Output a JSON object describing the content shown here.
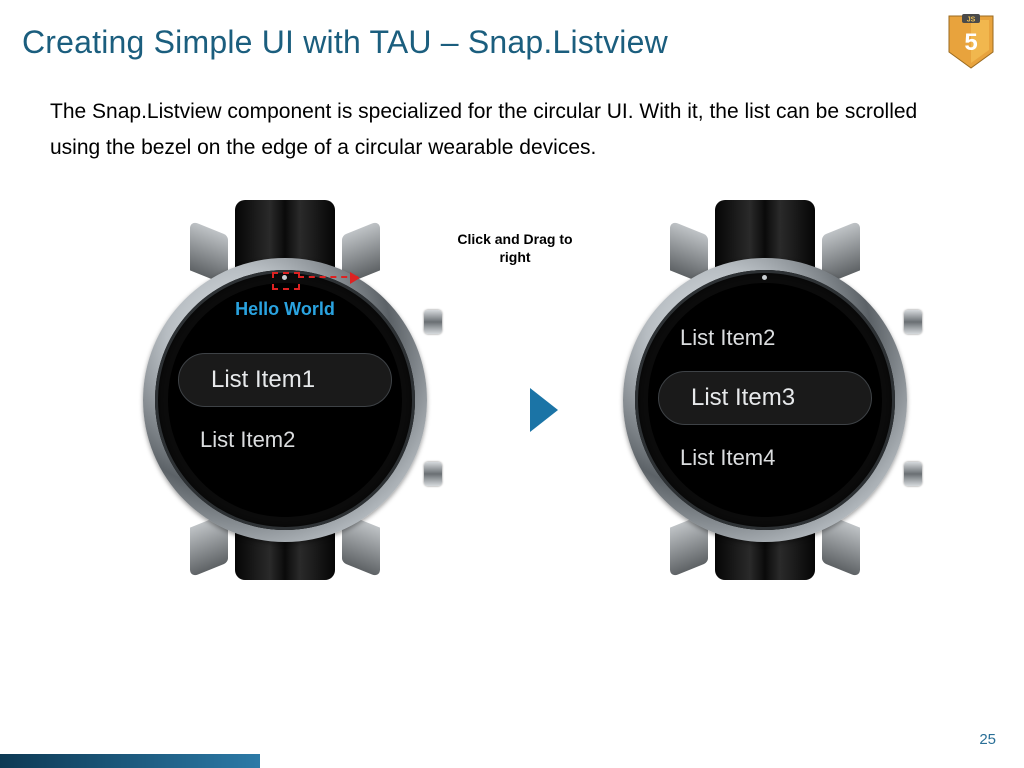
{
  "title": "Creating Simple UI with TAU – Snap.Listview",
  "body": "The Snap.Listview component is specialized for the circular UI. With it, the list can be scrolled using the bezel on the edge of a circular wearable devices.",
  "hint": "Click and Drag to right",
  "page_number": "25",
  "watches": {
    "left": {
      "header": "Hello World",
      "items": [
        "List Item1",
        "List Item2"
      ],
      "selected_index": 0
    },
    "right": {
      "header": "",
      "items": [
        "List Item2",
        "List Item3",
        "List Item4"
      ],
      "selected_index": 1
    }
  },
  "colors": {
    "title": "#1b5e7e",
    "accent_arrow": "#1b74a6",
    "list_header": "#2aa3e0",
    "drag_marker": "#d22"
  }
}
